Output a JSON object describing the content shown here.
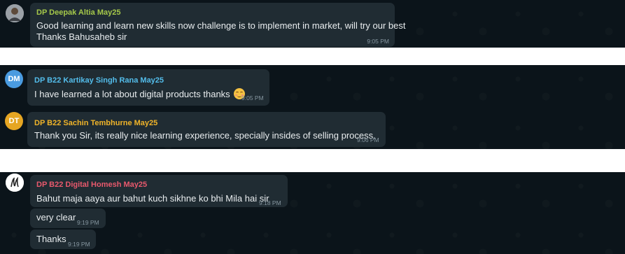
{
  "messages": {
    "deepak": {
      "sender": "DP Deepak Altia May25",
      "line1": "Good learning and learn new skills now challenge is to implement in market, will try our best",
      "line2": "Thanks Bahusaheb sir",
      "time": "9:05 PM",
      "color": "#a5c84a"
    },
    "kartikay": {
      "avatar_initials": "DM",
      "avatar_color": "#4a9be0",
      "sender": "DP B22 Kartikay Singh Rana May25",
      "text": "I have learned a lot about digital products thanks",
      "emoji_icon": "smiling-face-icon",
      "time": "9:05 PM",
      "color": "#53bdeb"
    },
    "sachin": {
      "avatar_initials": "DT",
      "avatar_color": "#e6a623",
      "sender": "DP B22 Sachin Tembhurne May25",
      "text": "Thank you Sir, its really nice learning experience, specially insides of selling process.",
      "time": "9:06 PM",
      "color": "#f0b429"
    },
    "homesh": {
      "sender": "DP B22 Digital Homesh May25",
      "text1": "Bahut maja aaya aur bahut kuch sikhne ko bhi Mila hai sir",
      "time1": "9:18 PM",
      "text2": "very clear",
      "time2": "9:19 PM",
      "text3": "Thanks",
      "time3": "9:19 PM",
      "color": "#e9596d"
    }
  }
}
